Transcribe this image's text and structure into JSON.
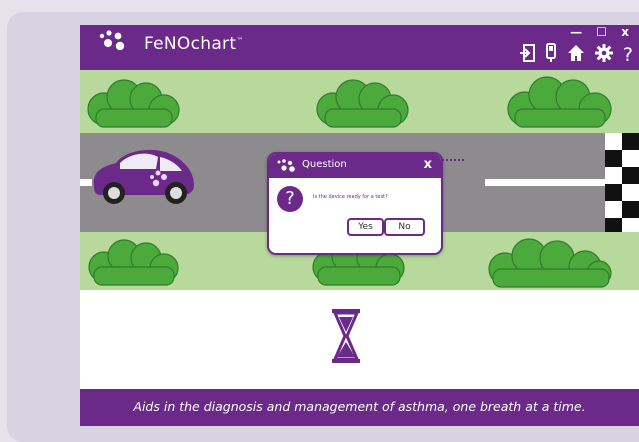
{
  "app": {
    "title": "FeNOchart",
    "trademark": "™",
    "colors": {
      "brand": "#6b2a8a",
      "grass": "#b7d99b",
      "road": "#8d8b8d",
      "bush": "#4caa3c"
    }
  },
  "window_controls": {
    "minimize": "—",
    "maximize": "☐",
    "close": "x"
  },
  "toolbar": {
    "icons": [
      "login-icon",
      "device-icon",
      "home-icon",
      "gear-icon",
      "help-icon"
    ],
    "help_label": "?"
  },
  "dialog": {
    "title": "Question",
    "close_label": "x",
    "icon_label": "?",
    "message": "Is the device ready for a test?",
    "yes_label": "Yes",
    "no_label": "No"
  },
  "footer": {
    "tagline": "Aids in the diagnosis and management of asthma, one breath at a time."
  }
}
